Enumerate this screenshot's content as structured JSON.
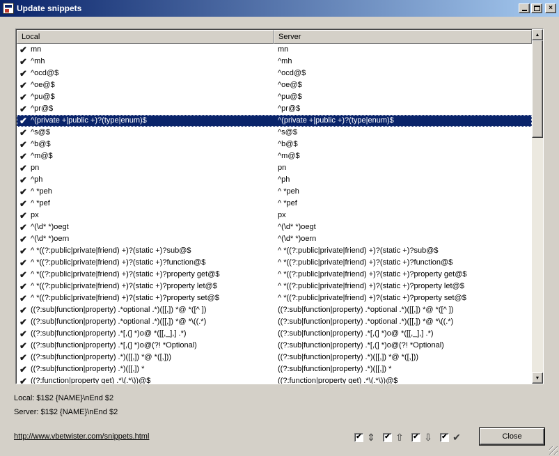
{
  "window": {
    "title": "Update snippets",
    "buttons": {
      "minimize": "_",
      "maximize": "□",
      "close": "×"
    }
  },
  "list": {
    "columns": {
      "local": "Local",
      "server": "Server"
    },
    "check_glyph": "✔",
    "selected_index": 6,
    "rows": [
      {
        "local": "mn",
        "server": "mn"
      },
      {
        "local": "^mh",
        "server": "^mh"
      },
      {
        "local": "^ocd@$",
        "server": "^ocd@$"
      },
      {
        "local": "^oe@$",
        "server": "^oe@$"
      },
      {
        "local": "^pu@$",
        "server": "^pu@$"
      },
      {
        "local": "^pr@$",
        "server": "^pr@$"
      },
      {
        "local": "^(private +|public +)?(type|enum)$",
        "server": "^(private +|public +)?(type|enum)$"
      },
      {
        "local": "^s@$",
        "server": "^s@$"
      },
      {
        "local": "^b@$",
        "server": "^b@$"
      },
      {
        "local": "^m@$",
        "server": "^m@$"
      },
      {
        "local": "pn",
        "server": "pn"
      },
      {
        "local": "^ph",
        "server": "^ph"
      },
      {
        "local": "^ *peh",
        "server": "^ *peh"
      },
      {
        "local": "^ *pef",
        "server": "^ *pef"
      },
      {
        "local": "px",
        "server": "px"
      },
      {
        "local": "^(\\d* *)oegt",
        "server": "^(\\d* *)oegt"
      },
      {
        "local": "^(\\d* *)oern",
        "server": "^(\\d* *)oern"
      },
      {
        "local": "^ *((?:public|private|friend) +)?(static +)?sub@$",
        "server": "^ *((?:public|private|friend) +)?(static +)?sub@$"
      },
      {
        "local": "^ *((?:public|private|friend) +)?(static +)?function@$",
        "server": "^ *((?:public|private|friend) +)?(static +)?function@$"
      },
      {
        "local": "^ *((?:public|private|friend) +)?(static +)?property get@$",
        "server": "^ *((?:public|private|friend) +)?(static +)?property get@$"
      },
      {
        "local": "^ *((?:public|private|friend) +)?(static +)?property let@$",
        "server": "^ *((?:public|private|friend) +)?(static +)?property let@$"
      },
      {
        "local": "^ *((?:public|private|friend) +)?(static +)?property set@$",
        "server": "^ *((?:public|private|friend) +)?(static +)?property set@$"
      },
      {
        "local": "((?:sub|function|property) .*optional .*)([[,]) *@ *([^ ])",
        "server": "((?:sub|function|property) .*optional .*)([[,]) *@ *([^ ])"
      },
      {
        "local": "((?:sub|function|property) .*optional .*)([[,]) *@ *\\((.*)",
        "server": "((?:sub|function|property) .*optional .*)([[,]) *@ *\\((.*)"
      },
      {
        "local": "((?:sub|function|property) .*[,(] *)o@ *([[,_],] .*)",
        "server": "((?:sub|function|property) .*[,(] *)o@ *([[,_],] .*)"
      },
      {
        "local": "((?:sub|function|property) .*[,(] *)o@(?! *Optional)",
        "server": "((?:sub|function|property) .*[,(] *)o@(?! *Optional)"
      },
      {
        "local": "((?:sub|function|property) .*)([[,]) *@ *([,]))",
        "server": "((?:sub|function|property) .*)([[,]) *@ *([,]))"
      },
      {
        "local": "((?:sub|function|property) .*)([[,]) *",
        "server": "((?:sub|function|property) .*)([[,]) *"
      },
      {
        "local": "((?:function|property get) .*\\(.*\\))@$",
        "server": "((?:function|property get) .*\\(.*\\))@$"
      }
    ]
  },
  "details": {
    "local": "Local: $1$2 {NAME}\\nEnd $2",
    "server": "Server: $1$2 {NAME}\\nEnd $2"
  },
  "link": {
    "text": "http://www.vbetwister.com/snippets.html"
  },
  "filters": [
    {
      "name": "filter-changed",
      "checked": true,
      "check_glyph": "✔",
      "icon": "up-down-arrow-icon",
      "glyph": "⇕"
    },
    {
      "name": "filter-upload",
      "checked": true,
      "check_glyph": "✔",
      "icon": "up-arrow-icon",
      "glyph": "⇧"
    },
    {
      "name": "filter-download",
      "checked": true,
      "check_glyph": "✔",
      "icon": "down-arrow-icon",
      "glyph": "⇩"
    },
    {
      "name": "filter-same",
      "checked": true,
      "check_glyph": "✔",
      "icon": "checkmark-icon",
      "glyph": "✔"
    }
  ],
  "close_button": {
    "label": "Close"
  }
}
